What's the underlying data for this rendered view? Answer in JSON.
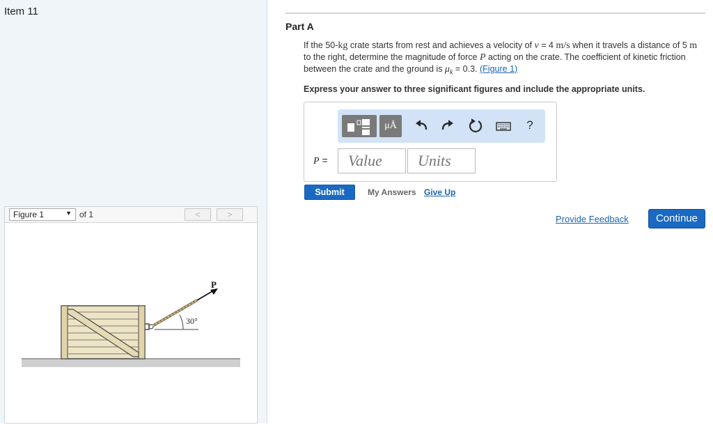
{
  "item": {
    "title": "Item 11"
  },
  "figure": {
    "selector": "Figure 1",
    "of_text": "of 1",
    "prev_label": "<",
    "next_label": ">",
    "force_label": "P",
    "angle_label": "30°"
  },
  "part": {
    "title": "Part A",
    "problem": {
      "t1": "If the 50-",
      "m1": "kg",
      "t2": " crate starts from rest and achieves a velocity of ",
      "m2": "v",
      "t3": " = 4 ",
      "m3": "m/s",
      "t4": " when it travels a distance of 5 ",
      "m4": "m",
      "t5": " to the right, determine the magnitude of force ",
      "m5": "P",
      "t6": " acting on the crate. The coefficient of kinetic friction between the crate and the ground is ",
      "m6": "μ",
      "m6_sub": "k",
      "t7": " = 0.3.",
      "figure_link": "(Figure 1)"
    },
    "instruction": "Express your answer to three significant figures and include the appropriate units."
  },
  "answer": {
    "label_var": "P",
    "label_eq": " =",
    "value_placeholder": "Value",
    "units_placeholder": "Units",
    "mu_label": "μÅ",
    "help_label": "?"
  },
  "actions": {
    "submit": "Submit",
    "my_answers": "My Answers",
    "give_up": "Give Up",
    "feedback": "Provide Feedback",
    "continue": "Continue"
  },
  "colors": {
    "accent": "#1b69c2",
    "toolbar_bg": "#d2e3f7",
    "left_panel_bg": "#f0f5fa"
  }
}
